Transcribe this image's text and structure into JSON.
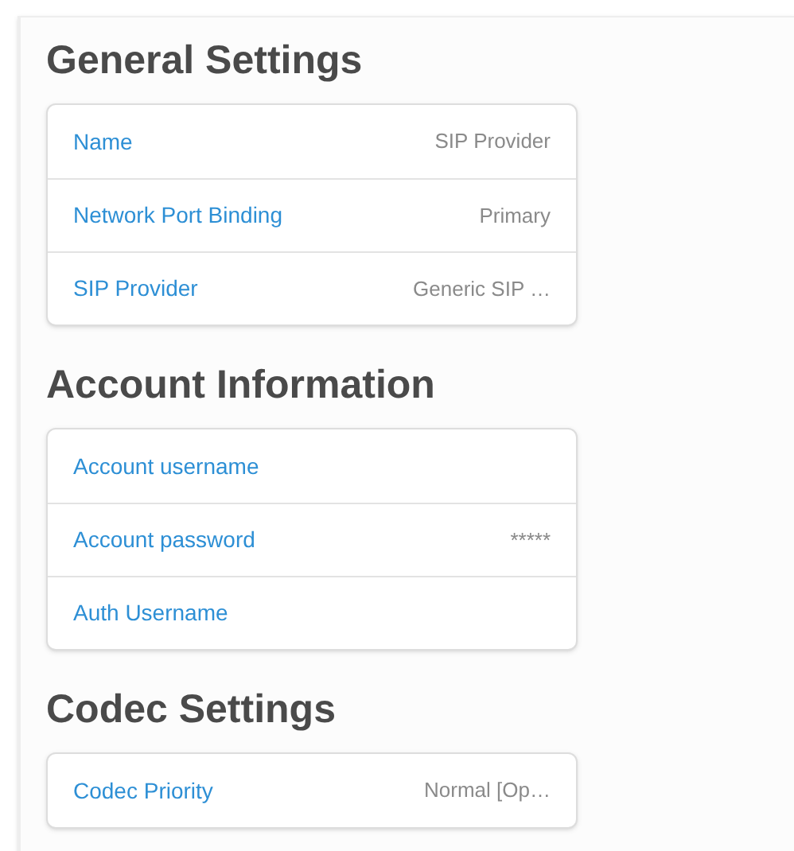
{
  "sections": [
    {
      "title": "General Settings",
      "rows": [
        {
          "label": "Name",
          "value": "SIP Provider"
        },
        {
          "label": "Network Port Binding",
          "value": "Primary"
        },
        {
          "label": "SIP Provider",
          "value": "Generic SIP …"
        }
      ]
    },
    {
      "title": "Account Information",
      "rows": [
        {
          "label": "Account username"
        },
        {
          "label": "Account password",
          "value": "*****"
        },
        {
          "label": "Auth Username"
        }
      ]
    },
    {
      "title": "Codec Settings",
      "rows": [
        {
          "label": "Codec Priority",
          "value": "Normal [Op…"
        }
      ]
    }
  ]
}
